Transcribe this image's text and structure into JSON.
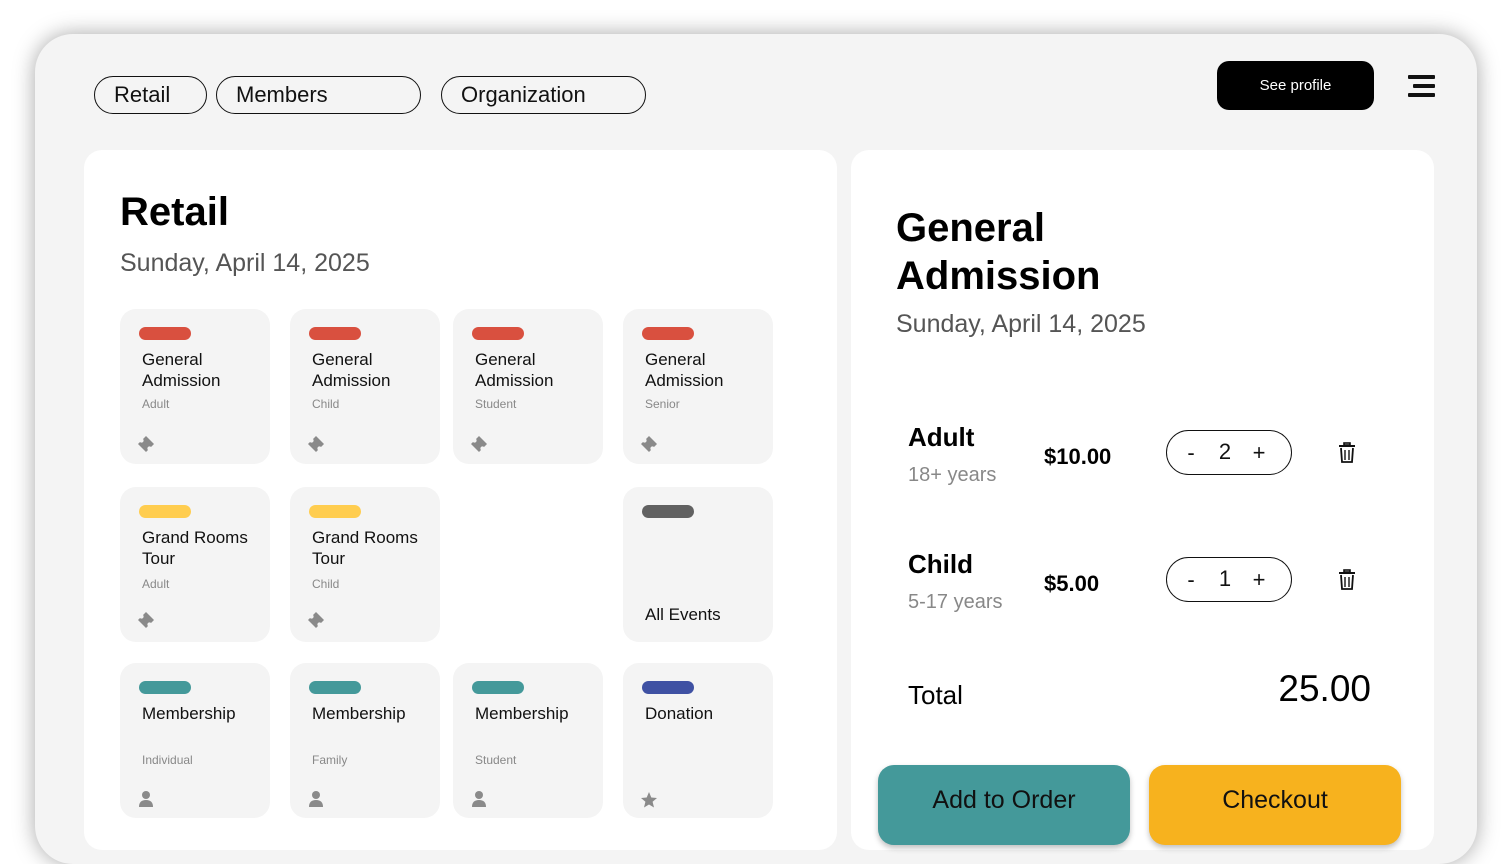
{
  "nav": {
    "tabs": [
      {
        "label": "Retail"
      },
      {
        "label": "Members"
      },
      {
        "label": "Organization"
      }
    ],
    "profile_label": "See profile",
    "menu_icon": "hamburger-menu-icon"
  },
  "retail": {
    "title": "Retail",
    "date": "Sunday, April 14, 2025",
    "tiles": [
      {
        "title": "General Admission",
        "subtitle": "Adult",
        "color": "#d9503f",
        "icon": "ticket-icon"
      },
      {
        "title": "General Admission",
        "subtitle": "Child",
        "color": "#d9503f",
        "icon": "ticket-icon"
      },
      {
        "title": "General Admission",
        "subtitle": "Student",
        "color": "#d9503f",
        "icon": "ticket-icon"
      },
      {
        "title": "General Admission",
        "subtitle": "Senior",
        "color": "#d9503f",
        "icon": "ticket-icon"
      },
      {
        "title": "Grand Rooms Tour",
        "subtitle": "Adult",
        "color": "#ffcd4f",
        "icon": "ticket-icon"
      },
      {
        "title": "Grand Rooms Tour",
        "subtitle": "Child",
        "color": "#ffcd4f",
        "icon": "ticket-icon"
      },
      {
        "title": "All Events",
        "color": "#616161"
      },
      {
        "title": "Membership",
        "subtitle": "Individual",
        "color": "#44999a",
        "icon": "person-icon"
      },
      {
        "title": "Membership",
        "subtitle": "Family",
        "color": "#44999a",
        "icon": "person-icon"
      },
      {
        "title": "Membership",
        "subtitle": "Student",
        "color": "#44999a",
        "icon": "person-icon"
      },
      {
        "title": "Donation",
        "color": "#3f51a3",
        "icon": "star-icon"
      }
    ]
  },
  "order": {
    "title": "General Admission",
    "date": "Sunday, April 14, 2025",
    "items": [
      {
        "name": "Adult",
        "age": "18+ years",
        "price": "$10.00",
        "qty": "2",
        "minus": "-",
        "plus": "+"
      },
      {
        "name": "Child",
        "age": "5-17 years",
        "price": "$5.00",
        "qty": "1",
        "minus": "-",
        "plus": "+"
      }
    ],
    "total_label": "Total",
    "total_value": "25.00",
    "add_label": "Add to Order",
    "checkout_label": "Checkout"
  },
  "colors": {
    "background": "#f4f4f4",
    "teal": "#44999a",
    "yellow": "#f7b21e"
  }
}
